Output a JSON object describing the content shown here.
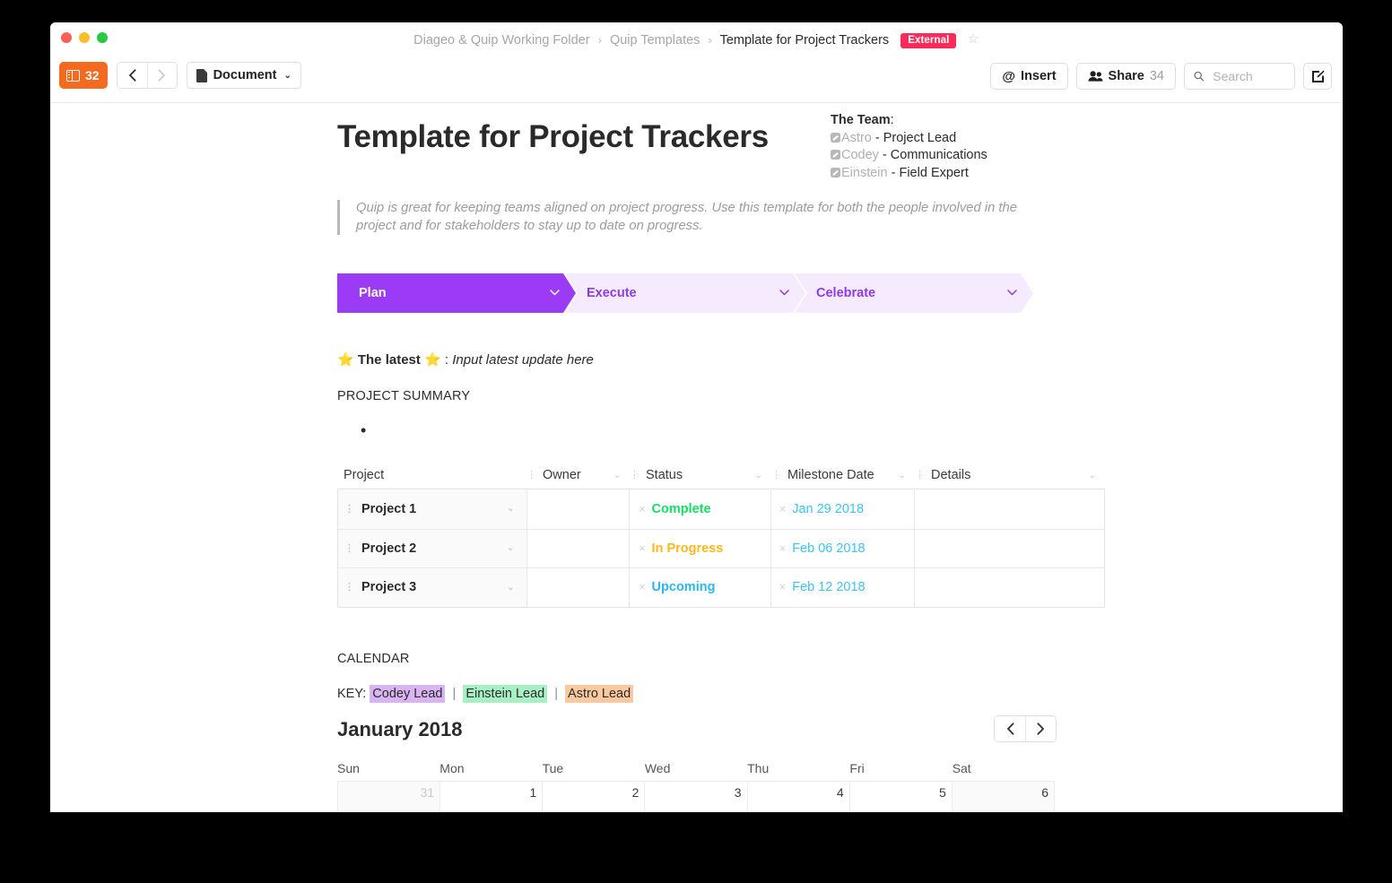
{
  "window": {
    "traffic_lights": [
      "close",
      "minimize",
      "maximize"
    ]
  },
  "breadcrumb": {
    "items": [
      "Diageo & Quip Working Folder",
      "Quip Templates"
    ],
    "current": "Template for Project Trackers",
    "badge": "External",
    "separator": "›",
    "star_icon": "☆"
  },
  "toolbar": {
    "sidebar_count": "32",
    "back_icon": "‹",
    "forward_icon": "›",
    "doc_menu_label": "Document",
    "caret": "⌄",
    "insert_label": "Insert",
    "insert_icon": "@",
    "share_label": "Share",
    "share_count": "34",
    "search_placeholder": "Search",
    "search_value": ""
  },
  "document": {
    "title": "Template for Project Trackers",
    "team": {
      "heading": "The Team",
      "heading_suffix": ":",
      "members": [
        {
          "name": "Astro",
          "role": "- Project Lead"
        },
        {
          "name": "Codey",
          "role": "- Communications"
        },
        {
          "name": "Einstein",
          "role": " - Field Expert"
        }
      ]
    },
    "quote": "Quip is great for keeping teams aligned on project progress. Use this template for both the people involved in the project and for stakeholders to stay up to date on progress.",
    "steps": [
      {
        "label": "Plan",
        "active": true
      },
      {
        "label": "Execute",
        "active": false
      },
      {
        "label": "Celebrate",
        "active": false
      }
    ],
    "latest": {
      "star": "⭐",
      "label": "The latest",
      "colon": ": ",
      "value": "Input latest update here"
    },
    "summary_heading": "PROJECT SUMMARY",
    "summary_bullet": "•",
    "calendar_heading": "CALENDAR"
  },
  "table": {
    "columns": [
      "Project",
      "Owner",
      "Status",
      "Milestone Date",
      "Details"
    ],
    "rows": [
      {
        "project": "Project 1",
        "owner": "",
        "status": "Complete",
        "status_color": "#13e164",
        "date": "Jan 29 2018",
        "details": ""
      },
      {
        "project": "Project 2",
        "owner": "",
        "status": "In Progress",
        "status_color": "#ffb81c",
        "date": "Feb 06 2018",
        "details": ""
      },
      {
        "project": "Project 3",
        "owner": "",
        "status": "Upcoming",
        "status_color": "#28b7f0",
        "date": "Feb 12 2018",
        "details": ""
      }
    ],
    "grip_icon": "⋮",
    "caret_icon": "⌄",
    "x_icon": "×"
  },
  "key": {
    "label": "KEY:",
    "entries": [
      {
        "text": "Codey Lead",
        "color": "#d9b3f2"
      },
      {
        "text": "Einstein Lead",
        "color": "#a7f0c4"
      },
      {
        "text": "Astro Lead",
        "color": "#fbc9a0"
      }
    ],
    "separator": "|"
  },
  "calendar": {
    "month_title": "January 2018",
    "prev_icon": "‹",
    "next_icon": "›",
    "day_names": [
      "Sun",
      "Mon",
      "Tue",
      "Wed",
      "Thu",
      "Fri",
      "Sat"
    ],
    "weeks": [
      [
        {
          "day": "31",
          "other_month": true
        },
        {
          "day": "1",
          "other_month": false
        },
        {
          "day": "2",
          "other_month": false
        },
        {
          "day": "3",
          "other_month": false
        },
        {
          "day": "4",
          "other_month": false
        },
        {
          "day": "5",
          "other_month": false
        },
        {
          "day": "6",
          "other_month": false
        }
      ]
    ]
  },
  "colors": {
    "accent_purple": "#9b3bf5",
    "step_inactive_bg": "#f6ebfe",
    "step_inactive_text": "#8d3ae8",
    "orange": "#f26b21",
    "badge_pink": "#f72c5b",
    "date_blue": "#3cc3f2"
  }
}
